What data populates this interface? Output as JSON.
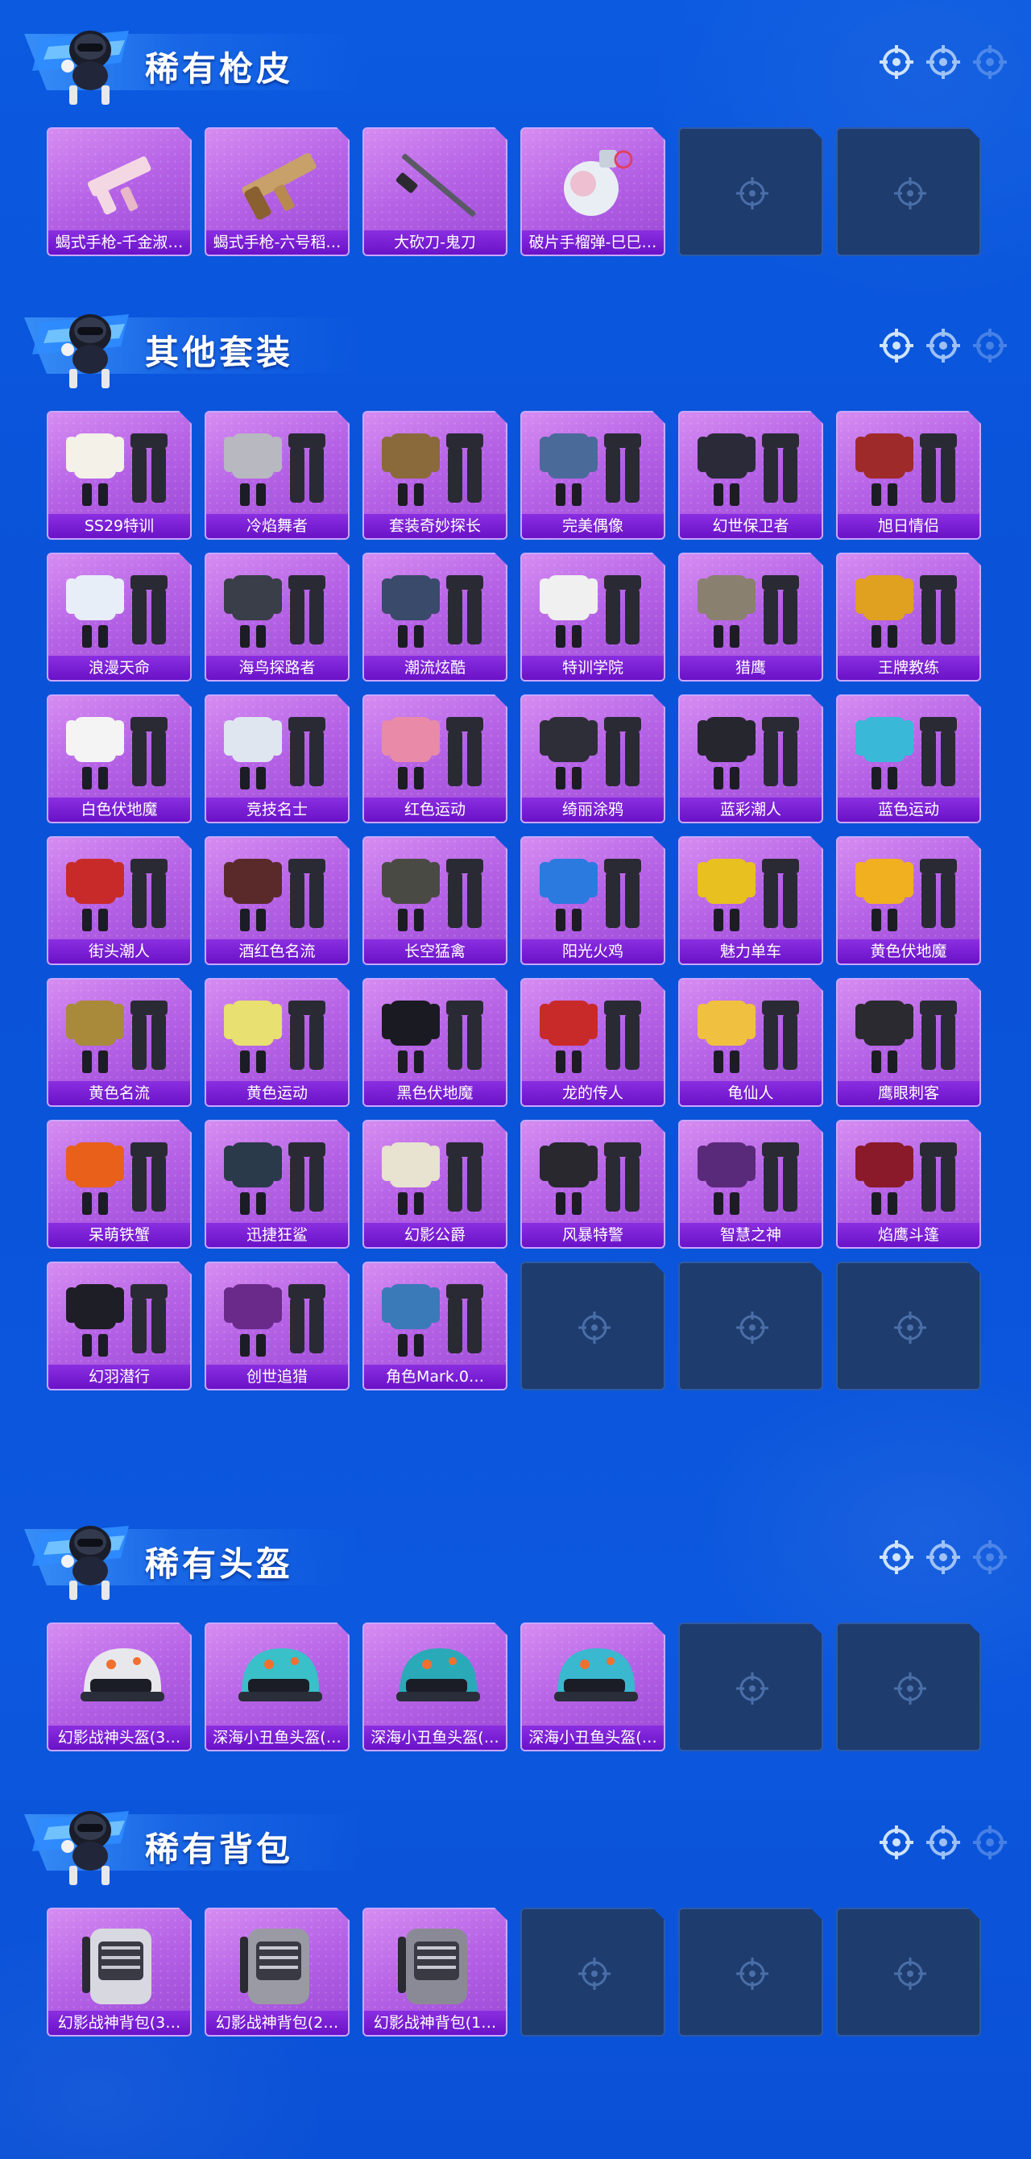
{
  "sections": [
    {
      "title": "稀有枪皮",
      "items": [
        {
          "label": "蝎式手枪-千金淑…",
          "art": "pistol-icon",
          "color": "#f3d8e4"
        },
        {
          "label": "蝎式手枪-六号稻…",
          "art": "rifle-icon",
          "color": "#c8a06a"
        },
        {
          "label": "大砍刀-鬼刀",
          "art": "sword-icon",
          "color": "#5a5a66"
        },
        {
          "label": "破片手榴弹-巳巳…",
          "art": "grenade-icon",
          "color": "#e9eef5"
        }
      ],
      "empty_slots": 2
    },
    {
      "title": "其他套装",
      "items": [
        {
          "label": "SS29特训",
          "art": "outfit-icon",
          "color": "#f3f1e8"
        },
        {
          "label": "冷焰舞者",
          "art": "outfit-icon",
          "color": "#b8b8c0"
        },
        {
          "label": "套装奇妙探长",
          "art": "outfit-icon",
          "color": "#8a6a3a"
        },
        {
          "label": "完美偶像",
          "art": "outfit-icon",
          "color": "#4a6a9a"
        },
        {
          "label": "幻世保卫者",
          "art": "outfit-icon",
          "color": "#2a2a38"
        },
        {
          "label": "旭日情侣",
          "art": "outfit-icon",
          "color": "#9e2a2a"
        },
        {
          "label": "浪漫天命",
          "art": "outfit-icon",
          "color": "#e8eef8"
        },
        {
          "label": "海鸟探路者",
          "art": "outfit-icon",
          "color": "#3a3e48"
        },
        {
          "label": "潮流炫酷",
          "art": "outfit-icon",
          "color": "#3a4a6a"
        },
        {
          "label": "特训学院",
          "art": "outfit-icon",
          "color": "#f0f0f0"
        },
        {
          "label": "猎鹰",
          "art": "outfit-icon",
          "color": "#8a8070"
        },
        {
          "label": "王牌教练",
          "art": "outfit-icon",
          "color": "#e0a020"
        },
        {
          "label": "白色伏地魔",
          "art": "outfit-icon",
          "color": "#f4f4f4"
        },
        {
          "label": "竞技名士",
          "art": "outfit-icon",
          "color": "#dfe6f0"
        },
        {
          "label": "红色运动",
          "art": "outfit-icon",
          "color": "#e88aa8"
        },
        {
          "label": "绮丽涂鸦",
          "art": "outfit-icon",
          "color": "#2e2e38"
        },
        {
          "label": "蓝彩潮人",
          "art": "outfit-icon",
          "color": "#26262e"
        },
        {
          "label": "蓝色运动",
          "art": "outfit-icon",
          "color": "#3ab8d8"
        },
        {
          "label": "街头潮人",
          "art": "outfit-icon",
          "color": "#c82a2a"
        },
        {
          "label": "酒红色名流",
          "art": "outfit-icon",
          "color": "#5a2a2a"
        },
        {
          "label": "长空猛禽",
          "art": "outfit-icon",
          "color": "#4a4a44"
        },
        {
          "label": "阳光火鸡",
          "art": "outfit-icon",
          "color": "#2a7ae0"
        },
        {
          "label": "魅力单车",
          "art": "outfit-icon",
          "color": "#e8c020"
        },
        {
          "label": "黄色伏地魔",
          "art": "outfit-icon",
          "color": "#f0b020"
        },
        {
          "label": "黄色名流",
          "art": "outfit-icon",
          "color": "#a88a3a"
        },
        {
          "label": "黄色运动",
          "art": "outfit-icon",
          "color": "#e8e070"
        },
        {
          "label": "黑色伏地魔",
          "art": "outfit-icon",
          "color": "#1a1a22"
        },
        {
          "label": "龙的传人",
          "art": "outfit-icon",
          "color": "#c82a2a"
        },
        {
          "label": "龟仙人",
          "art": "outfit-icon",
          "color": "#f0c040"
        },
        {
          "label": "鹰眼刺客",
          "art": "outfit-icon",
          "color": "#2a2a30"
        },
        {
          "label": "呆萌铁蟹",
          "art": "outfit-icon",
          "color": "#e8601a"
        },
        {
          "label": "迅捷狂鲨",
          "art": "outfit-icon",
          "color": "#2a3a4a"
        },
        {
          "label": "幻影公爵",
          "art": "outfit-icon",
          "color": "#e8e2d0"
        },
        {
          "label": "风暴特警",
          "art": "outfit-icon",
          "color": "#28282e"
        },
        {
          "label": "智慧之神",
          "art": "outfit-icon",
          "color": "#5a2a7a"
        },
        {
          "label": "焰鹰斗篷",
          "art": "outfit-icon",
          "color": "#8a1a2a"
        },
        {
          "label": "幻羽潜行",
          "art": "outfit-icon",
          "color": "#1e1e26"
        },
        {
          "label": "创世追猎",
          "art": "outfit-icon",
          "color": "#6a2a8a"
        },
        {
          "label": "角色Mark.0…",
          "art": "outfit-icon",
          "color": "#3a7ab8"
        }
      ],
      "empty_slots": 3
    },
    {
      "title": "稀有头盔",
      "items": [
        {
          "label": "幻影战神头盔(3…",
          "art": "helmet-icon",
          "color": "#e8e8ec"
        },
        {
          "label": "深海小丑鱼头盔(…",
          "art": "helmet-icon",
          "color": "#3ac0c8"
        },
        {
          "label": "深海小丑鱼头盔(…",
          "art": "helmet-icon",
          "color": "#2aaab8"
        },
        {
          "label": "深海小丑鱼头盔(…",
          "art": "helmet-icon",
          "color": "#3ab8d0"
        }
      ],
      "empty_slots": 2
    },
    {
      "title": "稀有背包",
      "items": [
        {
          "label": "幻影战神背包(3…",
          "art": "backpack-icon",
          "color": "#d8d8e0"
        },
        {
          "label": "幻影战神背包(2…",
          "art": "backpack-icon",
          "color": "#9a9aa4"
        },
        {
          "label": "幻影战神背包(1…",
          "art": "backpack-icon",
          "color": "#8a8a96"
        }
      ],
      "empty_slots": 3
    }
  ]
}
